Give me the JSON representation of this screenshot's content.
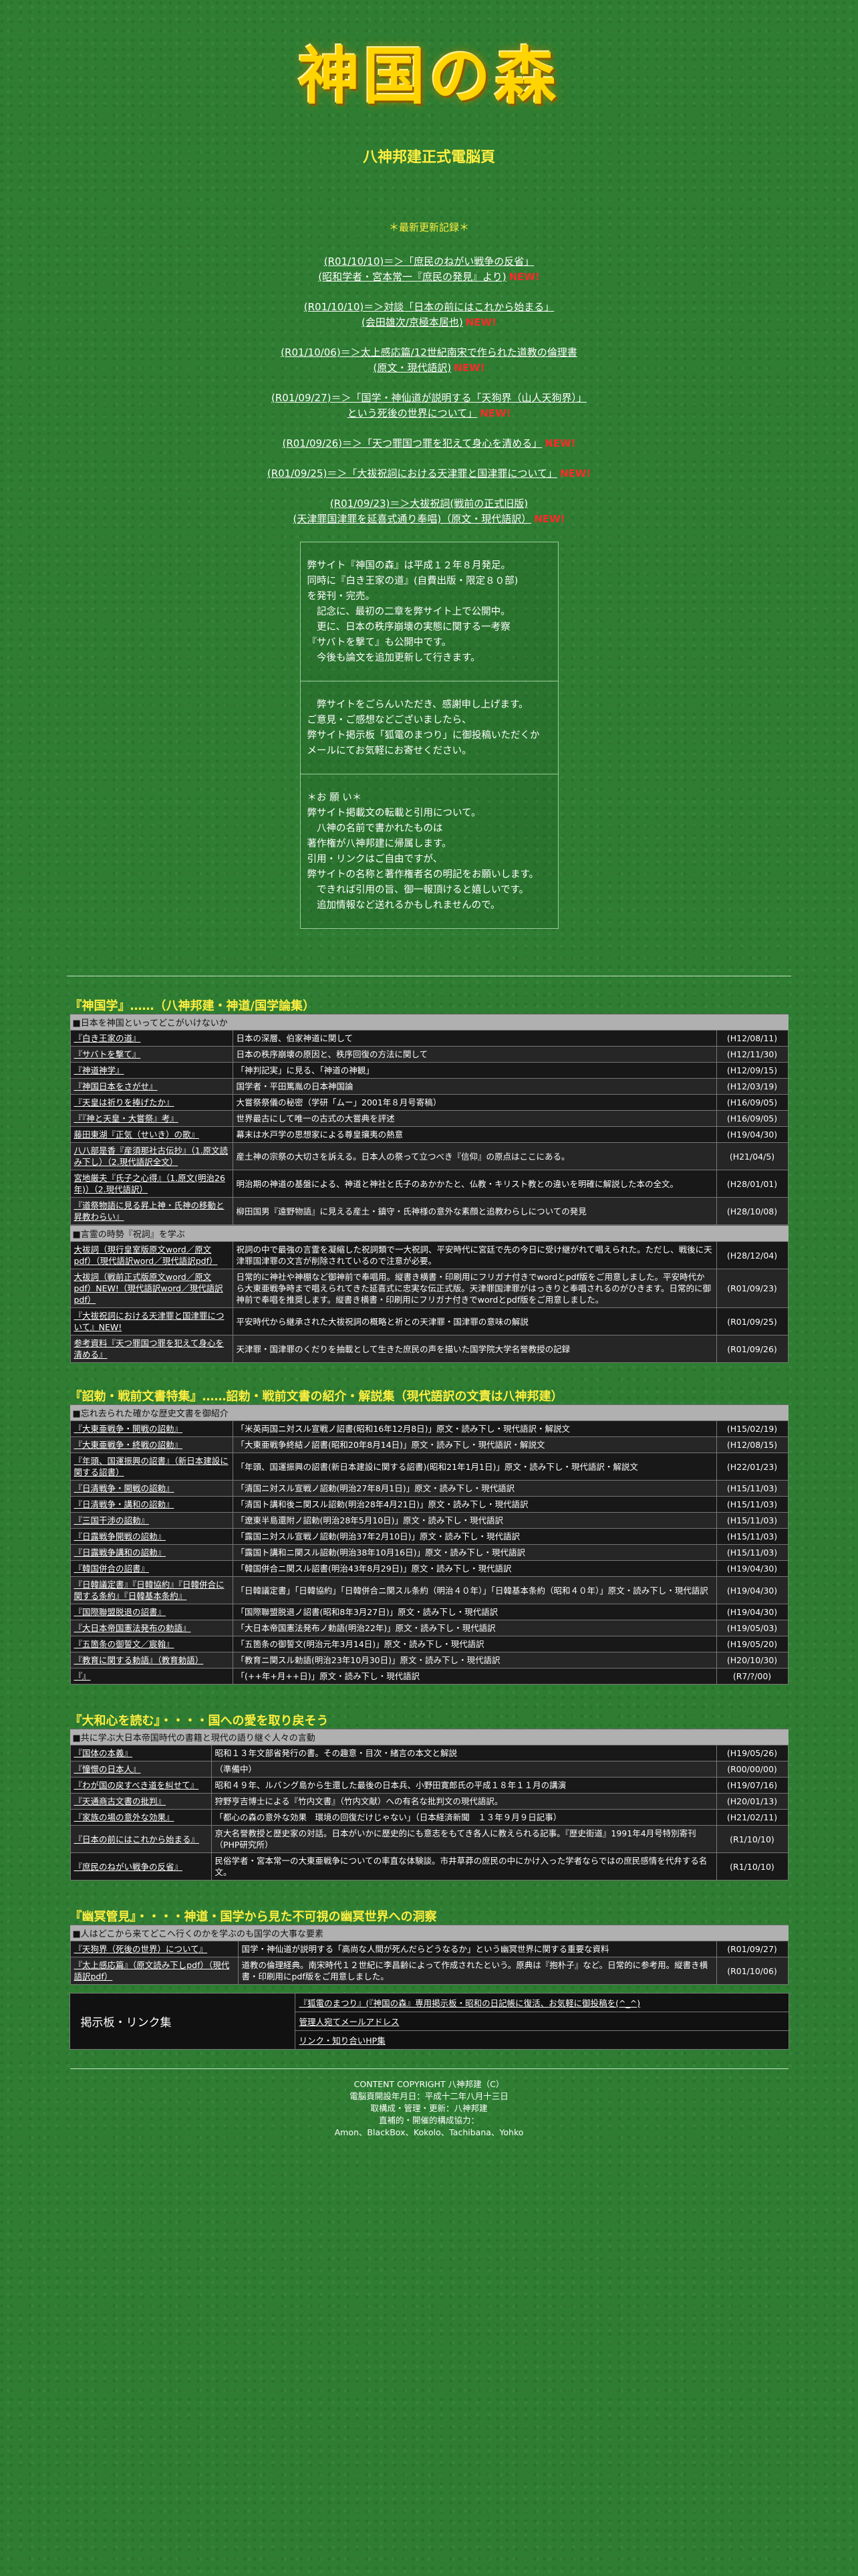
{
  "header": {
    "logo_text": "神国の森",
    "subtitle": "八神邦建正式電脳頁"
  },
  "updates": {
    "title": "＊最新更新記録＊",
    "items": [
      {
        "l1": "(R01/10/10)＝＞「庶民のねがい戦争の反省」",
        "l2": "(昭和学者・宮本常一『庶民の発見』より)",
        "new": "NEW!"
      },
      {
        "l1": "(R01/10/10)＝＞対談「日本の前にはこれから始まる」",
        "l2": "(会田雄次/京極本居也)",
        "new": "NEW!"
      },
      {
        "l1": "(R01/10/06)＝＞太上感応篇/12世紀南宋で作られた道教の倫理書",
        "l2": "(原文・現代語訳)",
        "new": "NEW!"
      },
      {
        "l1": "(R01/09/27)＝＞「国学・神仙道が説明する「天狗界（山人天狗界）」",
        "l2": "という死後の世界について」",
        "new": "NEW!"
      },
      {
        "l1": "(R01/09/26)＝＞「天つ罪国つ罪を犯えて身心を清める」",
        "l2": "",
        "new": "NEW!"
      },
      {
        "l1": "(R01/09/25)＝＞「大祓祝詞における天津罪と国津罪について」",
        "l2": "",
        "new": "NEW!"
      },
      {
        "l1": "(R01/09/23)＝＞大祓祝詞(戦前の正式旧版)",
        "l2": "(天津罪国津罪を延喜式通り奉唱)（原文・現代語訳）",
        "new": "NEW!"
      }
    ]
  },
  "info": {
    "sec1": [
      "弊サイト『神国の森』は平成１２年８月発足。",
      "同時に『白き王家の道』(自費出版・限定８０部)",
      "を発刊・完売。",
      "　記念に、最初の二章を弊サイト上で公開中。",
      "　更に、日本の秩序崩壊の実態に関する一考察",
      "『サバトを撃て』も公開中です。",
      "　今後も論文を追加更新して行きます。"
    ],
    "sec2": [
      "　弊サイトをごらんいただき、感謝申し上げます。",
      "ご意見・ご感想などございましたら、",
      "弊サイト掲示板「狐電のまつり」に御投稿いただくか",
      "メールにてお気軽にお寄せください。"
    ],
    "sec3": [
      "＊お 願 い＊",
      "弊サイト掲載文の転載と引用について。",
      "　八神の名前で書かれたものは",
      "著作権が八神邦建に帰属します。",
      "引用・リンクはご自由ですが、",
      "弊サイトの名称と著作権者名の明記をお願いします。",
      "　できれば引用の旨、御一報頂けると嬉しいです。",
      "　追加情報など送れるかもしれませんので。"
    ]
  },
  "s1": {
    "title": "『神国学』……（八神邦建・神道/国学論集）",
    "group1": "■日本を神国といってどこがいけないか",
    "rows1": [
      [
        "『白き王家の道』",
        "日本の深層、伯家神道に関して",
        "(H12/08/11)"
      ],
      [
        "『サバトを撃て』",
        "日本の秩序崩壊の原因と、秩序回復の方法に関して",
        "(H12/11/30)"
      ],
      [
        "『神道神学』",
        "「神判記実」に見る、「神道の神観」",
        "(H12/09/15)"
      ],
      [
        "『神国日本をさがせ』",
        "国学者・平田篤胤の日本神国論",
        "(H12/03/19)"
      ],
      [
        "『天皇は祈りを捧げたか』",
        "大嘗祭祭儀の秘密（学研「ムー」2001年８月号寄稿）",
        "(H16/09/05)"
      ],
      [
        "『『神と天皇・大嘗祭』考』",
        "世界最古にして唯一の古式の大嘗典を評述",
        "(H16/09/05)"
      ],
      [
        "藤田東湖『正気（せいき）の歌』",
        "幕末は水戸学の思想家による尊皇攘夷の熱意",
        "(H19/04/30)"
      ],
      [
        "八八部是香『産須那社古伝抄』（1.原文読み下し）（2.現代語訳全文）",
        "産土神の宗祭の大切さを訴える。日本人の祭って立つべき『信仰』の原点はここにある。",
        "(H21/04/5)"
      ],
      [
        "宮地厳夫『氏子之心得』（1.原文(明治26年)）（2.現代語訳）",
        "明治期の神道の基盤による、神道と神社と氏子のあかかたと、仏教・キリスト教との違いを明確に解説した本の全文。",
        "(H28/01/01)"
      ],
      [
        "『道祭物語に見る昇上神・氏神の移動と昇教わらい』",
        "柳田国男『遠野物語』に見える産土・鎮守・氏神様の意外な素顔と追教わらしについての発見",
        "(H28/10/08)"
      ]
    ],
    "group2": "■言霊の時勢『祝詞』を学ぶ",
    "rows2": [
      [
        "大祓詞（現行皇室版原文word／原文pdf）（現代語訳word／現代語訳pdf）",
        "祝詞の中で最強の言霊を凝縮した祝詞類で一大祝詞、平安時代に宮廷で先の今日に受け継がれて唱えられた。ただし、戦後に天津罪国津罪の文言が削除されているので注意が必要。",
        "(H28/12/04)"
      ],
      [
        "大祓詞（戦前正式版原文word／原文pdf）NEW!（現代語訳word／現代語訳pdf）",
        "日常的に神社や神棚など御神前で奉唱用。縦書き横書・印刷用にフリガナ付きでwordとpdf版をご用意しました。平安時代から大東亜戦争時まで唱えられてきた延喜式に忠実な伝正式版。天津罪国津罪がはっきりと奉唱されるのがひきます。日常的に御神前で奉唱を推奨します。縦書き横書・印刷用にフリガナ付きでwordとpdf版をご用意しました。",
        "(R01/09/23)"
      ],
      [
        "『大祓祝詞における天津罪と国津罪について』NEW!",
        "平安時代から継承された大祓祝詞の概略と祈との天津罪・国津罪の意味の解説",
        "(R01/09/25)"
      ],
      [
        "参考資料『天つ罪国つ罪を犯えて身心を清める』",
        "天津罪・国津罪のくだりを抽載として生きた庶民の声を描いた国学院大学名誉教授の記録",
        "(R01/09/26)"
      ]
    ]
  },
  "s2": {
    "title": "『詔勅・戦前文書特集』……詔勅・戦前文書の紹介・解説集（現代語訳の文責は八神邦建）",
    "group": "■忘れ去られた確かな歴史文書を御紹介",
    "rows": [
      [
        "『大東亜戦争・開戦の詔勅』",
        "「米英両国ニ対スル宣戦ノ詔書(昭和16年12月8日)」原文・読み下し・現代語訳・解説文",
        "(H15/02/19)"
      ],
      [
        "『大東亜戦争・終戦の詔勅』",
        "「大東亜戦争終結ノ詔書(昭和20年8月14日)」原文・読み下し・現代語訳・解説文",
        "(H12/08/15)"
      ],
      [
        "『年頭、国運振興の詔書』（新日本建設に関する詔書）",
        "「年頭、国運振興の詔書(新日本建設に関する詔書)(昭和21年1月1日)」原文・読み下し・現代語訳・解説文",
        "(H22/01/23)"
      ],
      [
        "『日清戦争・開戦の詔勅』",
        "「清国ニ対スル宣戦ノ詔勅(明治27年8月1日)」原文・読み下し・現代語訳",
        "(H15/11/03)"
      ],
      [
        "『日清戦争・講和の詔勅』",
        "「清国ト講和後ニ関スル詔勅(明治28年4月21日)」原文・読み下し・現代語訳",
        "(H15/11/03)"
      ],
      [
        "『三国干渉の詔勅』",
        "「遼東半島還附ノ詔勅(明治28年5月10日)」原文・読み下し・現代語訳",
        "(H15/11/03)"
      ],
      [
        "『日露戦争開戦の詔勅』",
        "「露国ニ対スル宣戦ノ詔勅(明治37年2月10日)」原文・読み下し・現代語訳",
        "(H15/11/03)"
      ],
      [
        "『日露戦争講和の詔勅』",
        "「露国ト講和ニ関スル詔勅(明治38年10月16日)」原文・読み下し・現代語訳",
        "(H15/11/03)"
      ],
      [
        "『韓国併合の詔書』",
        "「韓国併合ニ関スル詔書(明治43年8月29日)」原文・読み下し・現代語訳",
        "(H19/04/30)"
      ],
      [
        "『日韓議定書』『日韓協約』『日韓併合に関する条約』『日韓基本条約』",
        "「日韓議定書」「日韓協約」「日韓併合ニ関スル条約（明治４０年）」「日韓基本条約（昭和４０年）」原文・読み下し・現代語訳",
        "(H19/04/30)"
      ],
      [
        "『国際聯盟脱退の詔書』",
        "「国際聯盟脱退ノ詔書(昭和8年3月27日)」原文・読み下し・現代語訳",
        "(H19/04/30)"
      ],
      [
        "『大日本帝国憲法発布の勅語』",
        "「大日本帝国憲法発布ノ勅語(明治22年)」原文・読み下し・現代語訳",
        "(H19/05/03)"
      ],
      [
        "『五箇条の御誓文／宸翰』",
        "「五箇条の御誓文(明治元年3月14日)」原文・読み下し・現代語訳",
        "(H19/05/20)"
      ],
      [
        "『教育に関する勅語』（教育勅語）",
        "「教育ニ関スル勅語(明治23年10月30日)」原文・読み下し・現代語訳",
        "(H20/10/30)"
      ],
      [
        "『』",
        "「(++年+月++日)」原文・読み下し・現代語訳",
        "(R7/?/00)"
      ]
    ]
  },
  "s3": {
    "title": "『大和心を読む』・・・・国への愛を取り戻そう",
    "group": "■共に学ぶ大日本帝国時代の書籍と現代の語り継ぐ人々の言動",
    "rows": [
      [
        "『国体の本義』",
        "昭和１３年文部省発行の書。その趣意・目次・緒言の本文と解説",
        "(H19/05/26)"
      ],
      [
        "『憧憬の日本人』",
        "（準備中）",
        "(R00/00/00)"
      ],
      [
        "『わが国の戻すべき道を糾せて』",
        "昭和４９年、ルバング島から生還した最後の日本兵、小野田寛郎氏の平成１８年１１月の講演",
        "(H19/07/16)"
      ],
      [
        "『天通商古文書の批判』",
        "狩野亨吉博士による『竹内文書』（竹内文献）への有名な批判文の現代語訳。",
        "(H20/01/13)"
      ],
      [
        "『家族の場の意外な効果』",
        "「都心の森の意外な効果　環境の回復だけじゃない」（日本経済新聞　１３年９月９日記事）",
        "(H21/02/11)"
      ],
      [
        "『日本の前にはこれから始まる』",
        "京大名誉教授と歴史家の対話。日本がいかに歴史的にも意志をもてき各人に教えられる記事。『歴史街道』1991年4月号特別寄刊（PHP研究所）",
        "(R1/10/10)"
      ],
      [
        "『庶民のねがい戦争の反省』",
        "民俗学者・宮本常一の大東亜戦争についての率直な体験談。市井草莽の庶民の中にかけ入った学者ならではの庶民感情を代弁する名文。",
        "(R1/10/10)"
      ]
    ]
  },
  "s4": {
    "title": "『幽冥管見』・・・・神道・国学から見た不可視の幽冥世界への洞察",
    "group": "■人はどこから来てどこへ行くのかを学ぶのも国学の大事な要素",
    "rows": [
      [
        "『天狗界（死後の世界）について』",
        "国学・神仙道が説明する「高尚な人間が死んだらどうなるか」という幽冥世界に関する重要な資料",
        "(R01/09/27)"
      ],
      [
        "『太上感応篇』（原文読み下しpdf）（現代語訳pdf）",
        "道教の倫理経典。南宋時代１２世紀に李昌齢によって作成されたという。原典は『抱朴子』など。日常的に参考用。縦書き横書・印刷用にpdf版をご用意しました。",
        "(R01/10/06)"
      ]
    ]
  },
  "footer": {
    "left_label": "掲示板・リンク集",
    "links": [
      "『狐電のまつり』(『神国の森』専用掲示板・昭和の日記帳に復活、お気軽に御投稿を(^_^)",
      "管理人宛てメールアドレス",
      "リンク・知り合いHP集"
    ],
    "copy": [
      "CONTENT COPYRIGHT 八神邦建（C）",
      "電脳頁開設年月日：平成十二年八月十三日",
      "取構成・管理・更新：八神邦建",
      "直補的・開催的構成協力：",
      "Amon、BlackBox、Kokolo、Tachibana、Yohko"
    ]
  },
  "colors": {
    "background": "#2e7d32",
    "accent_yellow": "#ffef40",
    "new_red": "#ff2a2a"
  }
}
